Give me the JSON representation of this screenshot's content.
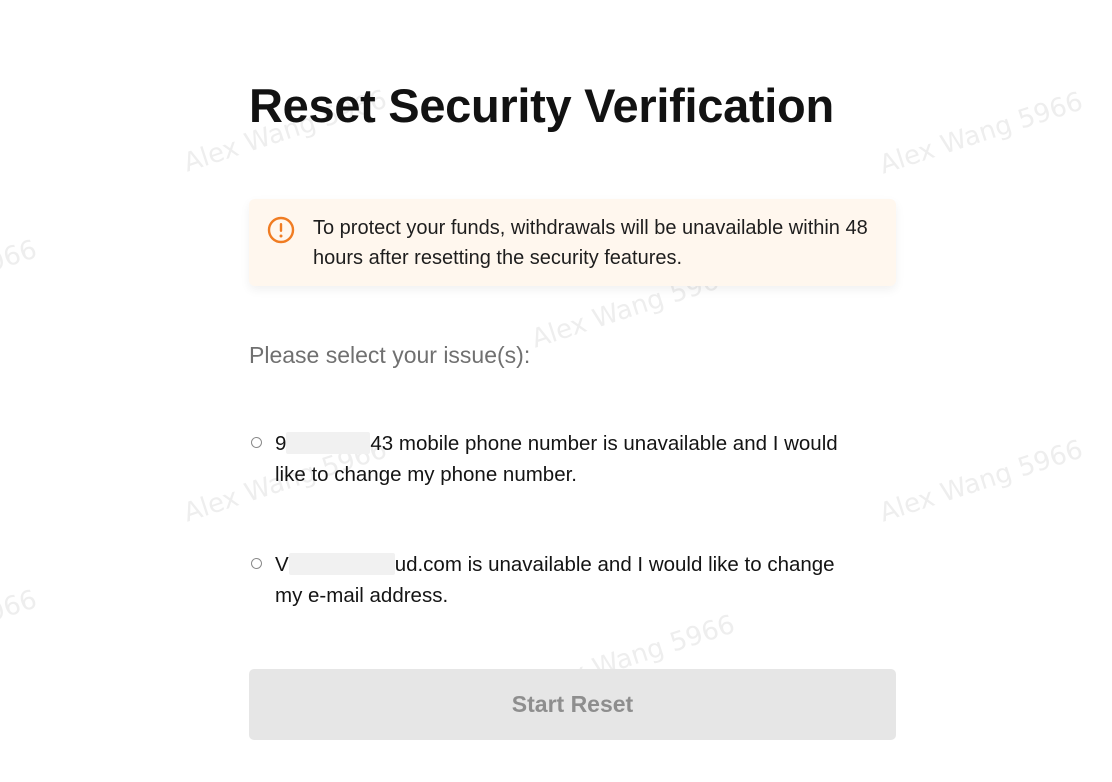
{
  "page": {
    "title": "Reset Security Verification"
  },
  "notice": {
    "icon": "warning-circle-icon",
    "icon_color": "#f07c22",
    "background_color": "#fff7ee",
    "text": "To protect your funds, withdrawals will be unavailable within 48 hours after resetting the security features."
  },
  "issues": {
    "prompt": "Please select your issue(s):",
    "options": [
      {
        "prefix": "9",
        "suffix": "43 mobile phone number is unavailable and I would like to change my phone number.",
        "selected": false
      },
      {
        "prefix": "V",
        "suffix": "ud.com is unavailable and I would like to change my e-mail address.",
        "selected": false
      }
    ]
  },
  "actions": {
    "start_reset_label": "Start Reset",
    "start_reset_enabled": false
  },
  "watermark": {
    "text": "Alex Wang 5966",
    "color": "#eeeeee"
  }
}
